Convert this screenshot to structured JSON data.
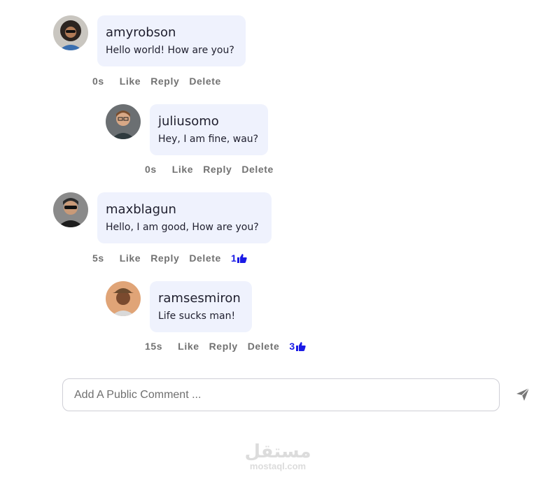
{
  "comments": [
    {
      "username": "amyrobson",
      "text": "Hello world! How are you?",
      "time": "0s",
      "like": "Like",
      "reply": "Reply",
      "delete": "Delete",
      "likes": ""
    },
    {
      "username": "juliusomo",
      "text": "Hey, I am fine, wau?",
      "time": "0s",
      "like": "Like",
      "reply": "Reply",
      "delete": "Delete",
      "likes": ""
    },
    {
      "username": "maxblagun",
      "text": "Hello, I am good, How are you?",
      "time": "5s",
      "like": "Like",
      "reply": "Reply",
      "delete": "Delete",
      "likes": "1"
    },
    {
      "username": "ramsesmiron",
      "text": "Life sucks man!",
      "time": "15s",
      "like": "Like",
      "reply": "Reply",
      "delete": "Delete",
      "likes": "3"
    }
  ],
  "comment_input": {
    "placeholder": "Add A Public Comment ...",
    "value": ""
  },
  "icons": {
    "send": "send-icon",
    "like": "thumbs-up-icon"
  },
  "colors": {
    "bubble": "#eff2fd",
    "like_count": "#1a1ae6",
    "action_text": "#727272"
  },
  "watermark": {
    "arabic": "مستقل",
    "latin": "mostaql.com"
  }
}
